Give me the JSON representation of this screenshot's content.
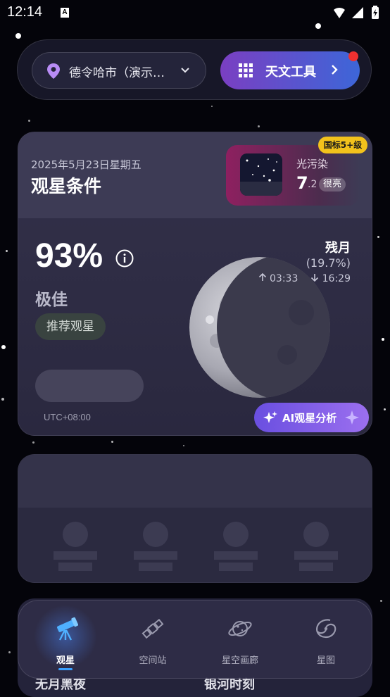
{
  "status_bar": {
    "time": "12:14",
    "notif_icon": "A"
  },
  "topbar": {
    "location": "德令哈市（演示…",
    "location_icon": "pin-icon",
    "tool_label": "天文工具",
    "colors": {
      "tool_gradient_start": "#7a3fc2",
      "tool_gradient_end": "#3d66d8",
      "notification_dot": "#ee3030"
    }
  },
  "conditions": {
    "date": "2025年5月23日星期五",
    "title": "观星条件",
    "light_pollution": {
      "label": "光污染",
      "value": "7",
      "value_decimal": ".2",
      "level": "很亮",
      "standard_badge": "国标5+级"
    },
    "score": "93%",
    "quality": "极佳",
    "recommend": "推荐观星",
    "timezone": "UTC+08:00",
    "moon": {
      "phase": "残月",
      "illumination": "(19.7%)",
      "rise": "03:33",
      "set": "16:29"
    },
    "ai_button": "AI观星分析"
  },
  "peek_card": {
    "left_title": "无月黑夜",
    "right_title": "银河时刻"
  },
  "nav": {
    "items": [
      {
        "label": "观星",
        "icon": "telescope-icon",
        "active": true
      },
      {
        "label": "空间站",
        "icon": "satellite-icon",
        "active": false
      },
      {
        "label": "星空画廊",
        "icon": "planet-icon",
        "active": false
      },
      {
        "label": "星图",
        "icon": "galaxy-icon",
        "active": false
      }
    ]
  }
}
